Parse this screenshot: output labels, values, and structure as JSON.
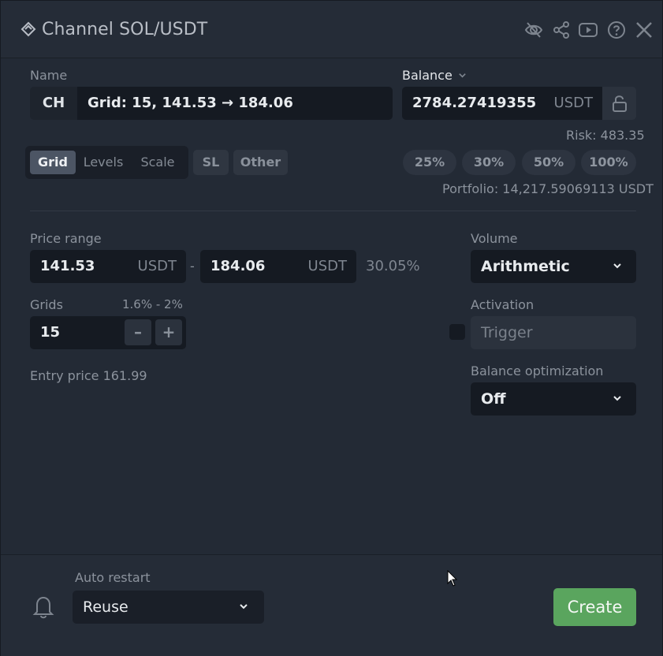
{
  "window": {
    "title": "Channel SOL/USDT",
    "icons": [
      "eye-off-icon",
      "share-icon",
      "youtube-icon",
      "help-icon",
      "close-icon"
    ]
  },
  "name_section": {
    "label": "Name",
    "prefix": "CH",
    "value": "Grid: 15, 141.53 → 184.06"
  },
  "balance": {
    "label": "Balance",
    "value": "2784.27419355",
    "unit": "USDT",
    "risk": "Risk: 483.35",
    "portfolio": "Portfolio: 14,217.59069113  USDT",
    "percent_buttons": [
      "25%",
      "30%",
      "50%",
      "100%"
    ]
  },
  "tabs": {
    "items": [
      "Grid",
      "Levels",
      "Scale"
    ],
    "active": "Grid",
    "extra": [
      "SL",
      "Other"
    ]
  },
  "price_range": {
    "label": "Price range",
    "from": "141.53",
    "to": "184.06",
    "unit": "USDT",
    "separator": "-",
    "percent": "30.05%"
  },
  "grids": {
    "label": "Grids",
    "range_hint": "1.6% - 2%",
    "value": "15",
    "minus": "–",
    "plus": "+"
  },
  "entry_price": "Entry price 161.99",
  "volume": {
    "label": "Volume",
    "value": "Arithmetic"
  },
  "activation": {
    "label": "Activation",
    "placeholder": "Trigger"
  },
  "balance_optimization": {
    "label": "Balance optimization",
    "value": "Off"
  },
  "footer": {
    "auto_restart_label": "Auto restart",
    "auto_restart_value": "Reuse",
    "create_label": "Create"
  },
  "colors": {
    "accent_green": "#5aa55e",
    "background": "#232a35",
    "input": "#151a22"
  }
}
